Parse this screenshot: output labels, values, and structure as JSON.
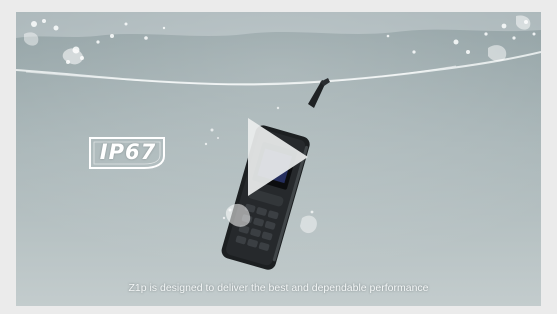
{
  "video": {
    "caption": "Z1p is designed to deliver the best and dependable performance",
    "badge_text": "IP67",
    "background_top": "#8e9ea1",
    "background_bottom": "#c3cccd",
    "play_icon": "play-icon",
    "play_color": "#e9ecec"
  }
}
